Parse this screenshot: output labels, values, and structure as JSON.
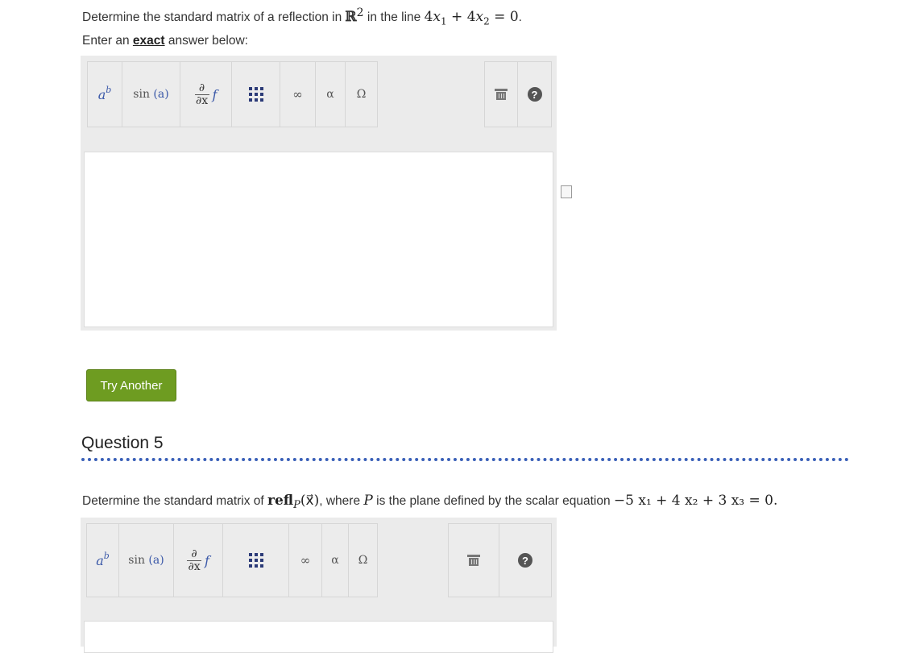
{
  "question4": {
    "prefix": "Determine the standard matrix of a reflection in",
    "space_symbol": "ℝ",
    "space_exp": "2",
    "mid": "in the line",
    "coef1": "4",
    "var1": "x",
    "sub1": "1",
    "plus": "+",
    "coef2": "4",
    "var2": "x",
    "sub2": "2",
    "eq": "= 0",
    "end": ".",
    "enter_pre": "Enter an",
    "enter_bold": "exact",
    "enter_post": "answer below:"
  },
  "toolbar": {
    "power_base": "a",
    "power_exp": "b",
    "sin_label": "sin",
    "sin_arg": "(a)",
    "deriv_num": "∂",
    "deriv_den": "∂x",
    "deriv_f": "f",
    "infinity": "∞",
    "alpha": "α",
    "omega": "Ω",
    "help": "?"
  },
  "try_another": "Try Another",
  "question5": {
    "title": "Question 5",
    "prefix": "Determine the standard matrix of",
    "refl": "refl",
    "refl_sub": "P",
    "arg": "(x⃗)",
    "mid": ", where",
    "P": "P",
    "rest": "is the plane defined by the scalar equation",
    "eq": "−5 x₁ + 4 x₂ + 3 x₃ = 0."
  }
}
